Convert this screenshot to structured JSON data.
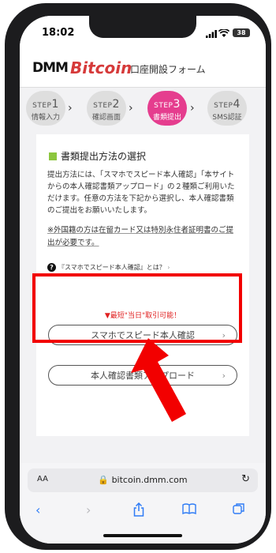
{
  "status": {
    "time": "18:02",
    "battery": "38"
  },
  "header": {
    "logo_dmm": "DMM",
    "logo_bitcoin": "Bitcoin",
    "title": "口座開設フォーム"
  },
  "steps": [
    {
      "step": "STEP",
      "num": "1",
      "label": "情報入力"
    },
    {
      "step": "STEP",
      "num": "2",
      "label": "確認画面"
    },
    {
      "step": "STEP",
      "num": "3",
      "label": "書類提出"
    },
    {
      "step": "STEP",
      "num": "4",
      "label": "SMS認証"
    }
  ],
  "section": {
    "title": "書類提出方法の選択",
    "desc": "提出方法には、「スマホでスピード本人確認」「本サイトからの本人確認書類アップロード」の２種類ご利用いただけます。任意の方法を下記から選択し、本人確認書類のご提出をお願いいたします。",
    "note": "※外国籍の方は在留カード又は特別永住者証明書のご提出が必要です。",
    "help": "『スマホでスピード本人確認』とは？"
  },
  "badge": "▼最短\"当日\"取引可能！",
  "buttons": {
    "speed": "スマホでスピード本人確認",
    "upload": "本人確認書類アップロード"
  },
  "browser": {
    "aa": "AA",
    "url": "bitcoin.dmm.com"
  },
  "colors": {
    "accent": "#e53d8e",
    "highlight": "#f20000",
    "brand_red": "#d63a3a"
  }
}
